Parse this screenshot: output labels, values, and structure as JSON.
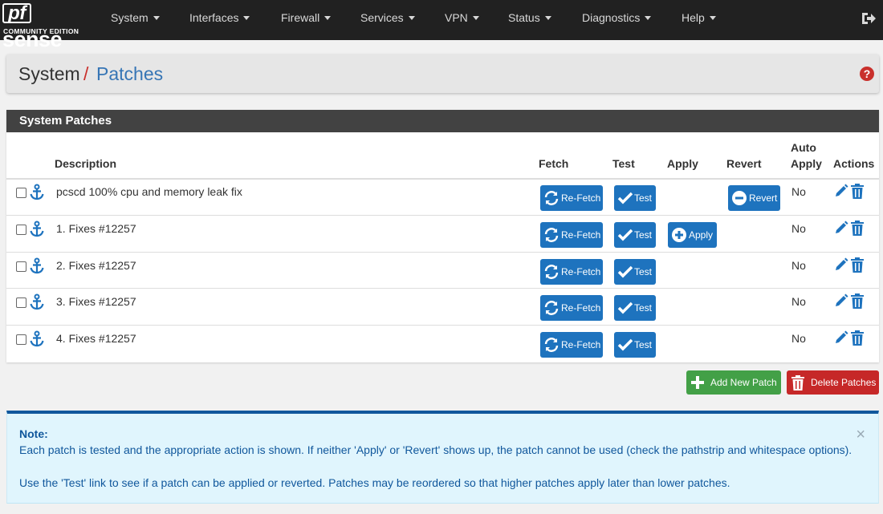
{
  "app": {
    "logo_word": "sense",
    "logo_pf": "pf",
    "logo_edition": "COMMUNITY EDITION"
  },
  "nav": {
    "items": [
      {
        "label": "System"
      },
      {
        "label": "Interfaces"
      },
      {
        "label": "Firewall"
      },
      {
        "label": "Services"
      },
      {
        "label": "VPN"
      },
      {
        "label": "Status"
      },
      {
        "label": "Diagnostics"
      },
      {
        "label": "Help"
      }
    ],
    "logout_icon": "sign-out-icon"
  },
  "breadcrumb": {
    "root": "System",
    "separator": "/",
    "leaf": "Patches",
    "help_glyph": "?"
  },
  "panel": {
    "title": "System Patches",
    "headers": {
      "description": "Description",
      "fetch": "Fetch",
      "test": "Test",
      "apply": "Apply",
      "revert": "Revert",
      "auto_apply_1": "Auto",
      "auto_apply_2": "Apply",
      "actions": "Actions"
    },
    "rows": [
      {
        "description": "pcscd 100% cpu and memory leak fix",
        "fetch": "Re-Fetch",
        "test": "Test",
        "apply": "",
        "revert": "Revert",
        "auto_apply": "No"
      },
      {
        "description": "1. Fixes #12257",
        "fetch": "Re-Fetch",
        "test": "Test",
        "apply": "Apply",
        "revert": "",
        "auto_apply": "No"
      },
      {
        "description": "2. Fixes #12257",
        "fetch": "Re-Fetch",
        "test": "Test",
        "apply": "",
        "revert": "",
        "auto_apply": "No"
      },
      {
        "description": "3. Fixes #12257",
        "fetch": "Re-Fetch",
        "test": "Test",
        "apply": "",
        "revert": "",
        "auto_apply": "No"
      },
      {
        "description": "4. Fixes #12257",
        "fetch": "Re-Fetch",
        "test": "Test",
        "apply": "",
        "revert": "",
        "auto_apply": "No"
      }
    ]
  },
  "buttons": {
    "add": "Add New Patch",
    "delete": "Delete Patches"
  },
  "note": {
    "title": "Note:",
    "line1": "Each patch is tested and the appropriate action is shown. If neither 'Apply' or 'Revert' shows up, the patch cannot be used (check the pathstrip and whitespace options).",
    "line2": "Use the 'Test' link to see if a patch can be applied or reverted. Patches may be reordered so that higher patches apply later than lower patches.",
    "close": "×"
  },
  "colors": {
    "navbar": "#212121",
    "primary": "#1e73be",
    "success": "#43a047",
    "danger": "#c62828",
    "note_bg": "#e0f5fd",
    "note_text": "#10579c"
  }
}
